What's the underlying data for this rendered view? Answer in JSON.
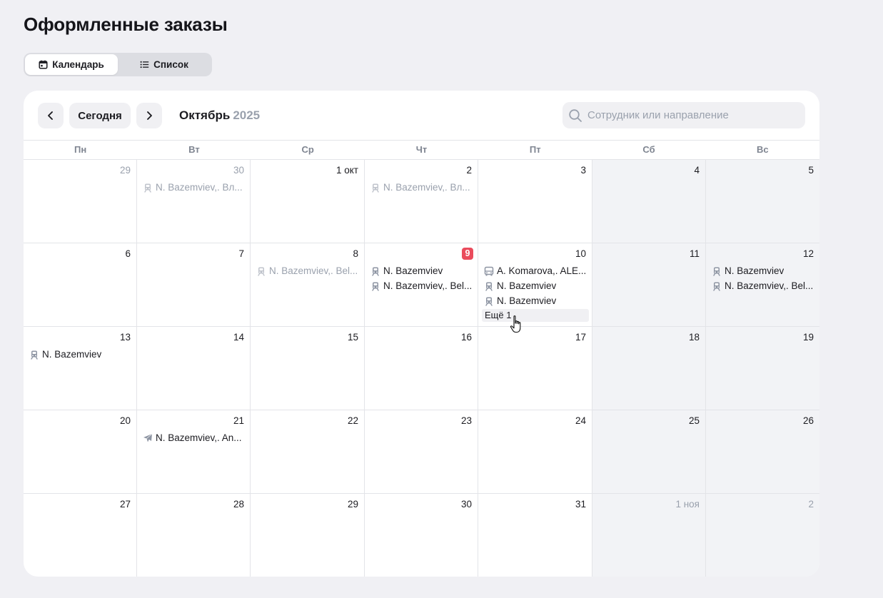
{
  "page": {
    "title": "Оформленные заказы"
  },
  "view_toggle": {
    "calendar_label": "Календарь",
    "list_label": "Список",
    "active": "calendar"
  },
  "toolbar": {
    "today_label": "Сегодня",
    "month": "Октябрь",
    "year": "2025",
    "search_placeholder": "Сотрудник или направление"
  },
  "weekdays": [
    "Пн",
    "Вт",
    "Ср",
    "Чт",
    "Пт",
    "Сб",
    "Вс"
  ],
  "weeks": [
    [
      {
        "day": "29",
        "muted": true,
        "events": []
      },
      {
        "day": "30",
        "muted": true,
        "events": [
          {
            "icon": "train-icon",
            "text": "N. Bazemviev,. Вл...",
            "muted": true
          }
        ]
      },
      {
        "day": "1 окт",
        "events": []
      },
      {
        "day": "2",
        "events": [
          {
            "icon": "train-icon",
            "text": "N. Bazemviev,. Вл...",
            "muted": true
          }
        ]
      },
      {
        "day": "3",
        "events": []
      },
      {
        "day": "4",
        "weekend": true,
        "events": []
      },
      {
        "day": "5",
        "weekend": true,
        "events": []
      }
    ],
    [
      {
        "day": "6",
        "events": []
      },
      {
        "day": "7",
        "events": []
      },
      {
        "day": "8",
        "events": [
          {
            "icon": "train-icon",
            "text": "N. Bazemviev,. Bel...",
            "muted": true
          }
        ]
      },
      {
        "day": "9",
        "today": true,
        "events": [
          {
            "icon": "train-icon",
            "text": "N. Bazemviev"
          },
          {
            "icon": "train-icon",
            "text": "N. Bazemviev,. Bel..."
          }
        ]
      },
      {
        "day": "10",
        "events": [
          {
            "icon": "bus-icon",
            "text": "A. Komarova,. ALE..."
          },
          {
            "icon": "train-icon",
            "text": "N. Bazemviev"
          },
          {
            "icon": "train-icon",
            "text": "N. Bazemviev"
          }
        ],
        "more": "Ещё 1"
      },
      {
        "day": "11",
        "weekend": true,
        "events": []
      },
      {
        "day": "12",
        "weekend": true,
        "events": [
          {
            "icon": "train-icon",
            "text": "N. Bazemviev"
          },
          {
            "icon": "train-icon",
            "text": "N. Bazemviev,. Bel..."
          }
        ]
      }
    ],
    [
      {
        "day": "13",
        "events": [
          {
            "icon": "train-icon",
            "text": "N. Bazemviev"
          }
        ]
      },
      {
        "day": "14",
        "events": []
      },
      {
        "day": "15",
        "events": []
      },
      {
        "day": "16",
        "events": []
      },
      {
        "day": "17",
        "events": []
      },
      {
        "day": "18",
        "weekend": true,
        "events": []
      },
      {
        "day": "19",
        "weekend": true,
        "events": []
      }
    ],
    [
      {
        "day": "20",
        "events": []
      },
      {
        "day": "21",
        "events": [
          {
            "icon": "plane-icon",
            "text": "N. Bazemviev,. An..."
          }
        ]
      },
      {
        "day": "22",
        "events": []
      },
      {
        "day": "23",
        "events": []
      },
      {
        "day": "24",
        "events": []
      },
      {
        "day": "25",
        "weekend": true,
        "events": []
      },
      {
        "day": "26",
        "weekend": true,
        "events": []
      }
    ],
    [
      {
        "day": "27",
        "events": []
      },
      {
        "day": "28",
        "events": []
      },
      {
        "day": "29",
        "events": []
      },
      {
        "day": "30",
        "events": []
      },
      {
        "day": "31",
        "events": []
      },
      {
        "day": "1 ноя",
        "weekend": true,
        "muted": true,
        "events": []
      },
      {
        "day": "2",
        "weekend": true,
        "muted": true,
        "events": []
      }
    ]
  ],
  "colors": {
    "today_badge": "#ea4b5c",
    "muted_text": "#9aa1ad",
    "weekend_bg": "#f2f3f6",
    "icon": "#8e95a3"
  }
}
